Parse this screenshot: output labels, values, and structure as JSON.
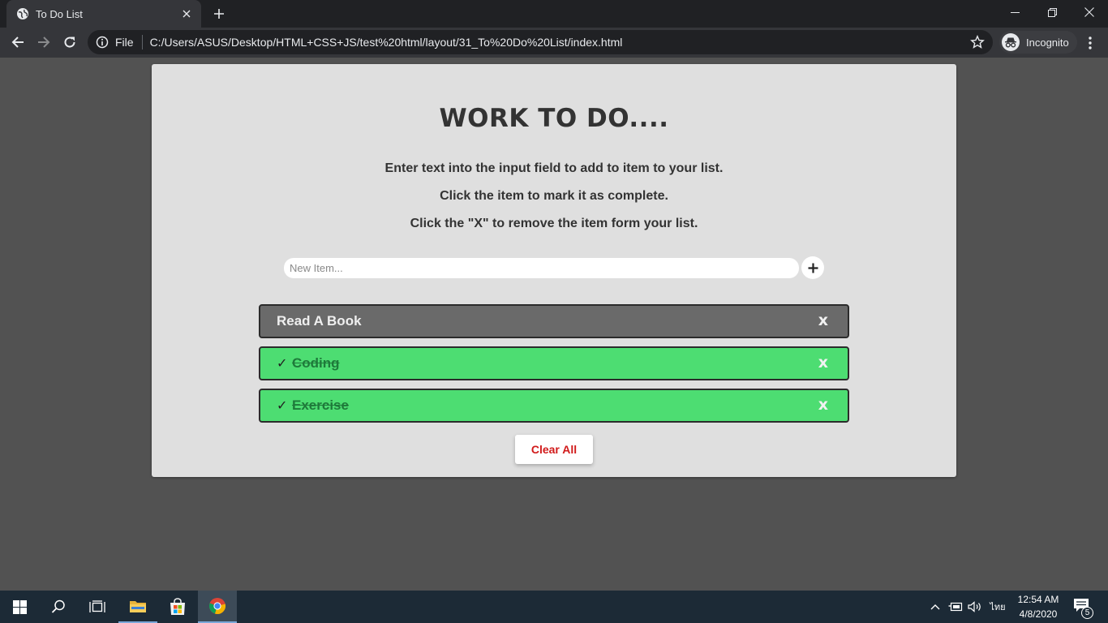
{
  "browser": {
    "tab_title": "To Do List",
    "file_label": "File",
    "url": "C:/Users/ASUS/Desktop/HTML+CSS+JS/test%20html/layout/31_To%20Do%20List/index.html",
    "incognito_label": "Incognito"
  },
  "app": {
    "heading": "WORK TO DO....",
    "instructions": [
      "Enter text into the input field to add to item to your list.",
      "Click the item to mark it as complete.",
      "Click the \"X\" to remove the item form your list."
    ],
    "input_placeholder": "New Item...",
    "add_symbol": "+",
    "items": [
      {
        "text": "Read A Book",
        "completed": false,
        "remove_label": "x"
      },
      {
        "text": "Coding",
        "completed": true,
        "check": "✓",
        "remove_label": "x"
      },
      {
        "text": "Exercise",
        "completed": true,
        "check": "✓",
        "remove_label": "x"
      }
    ],
    "clear_label": "Clear All"
  },
  "taskbar": {
    "time": "12:54 AM",
    "date": "4/8/2020",
    "language": "ไทย",
    "notification_count": "5"
  },
  "colors": {
    "page_bg": "#525252",
    "card_bg": "#dfdfdf",
    "pending_item": "#6a6a6a",
    "done_item": "#4ddd72",
    "clear_text": "#d11a1a"
  },
  "icons": {
    "tab_favicon": "globe-icon",
    "back": "arrow-left-icon",
    "forward": "arrow-right-icon",
    "reload": "reload-icon",
    "site_info": "info-icon",
    "bookmark": "star-icon",
    "menu": "kebab-icon"
  }
}
